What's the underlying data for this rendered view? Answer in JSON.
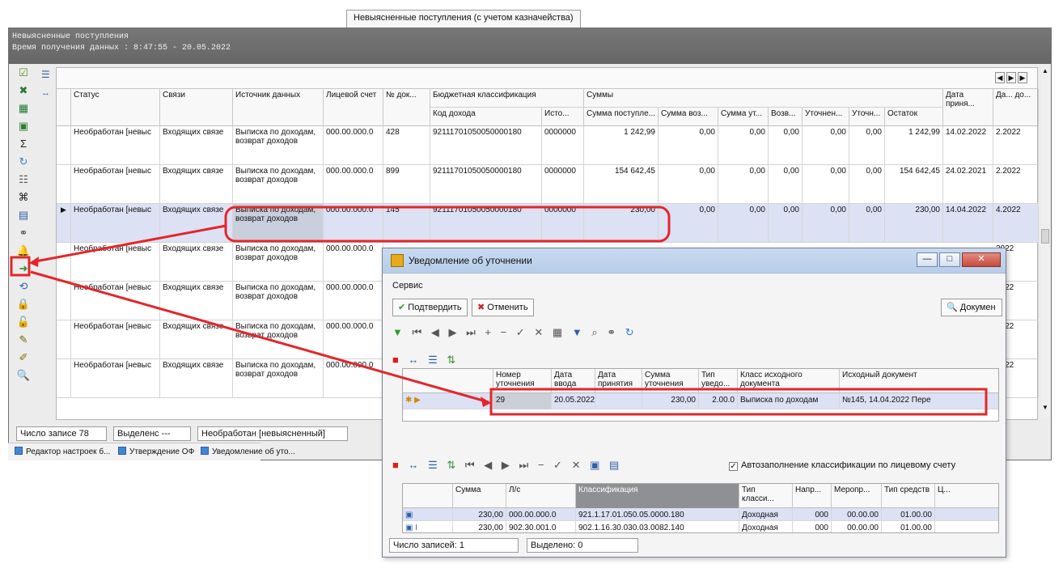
{
  "window": {
    "title_tab": "Невыясненные поступления (с учетом казначейства)",
    "header_line1": "Невыясненные поступления",
    "header_line2": "Время получения данных : 8:47:55 - 20.05.2022"
  },
  "colors": {
    "accent_red": "#e3262a",
    "highlight_blue": "#dce1f4",
    "header_gray": "#6d6d6d",
    "dialog_blue": "#c8daf1"
  },
  "left_toolbar_icons": [
    "check-icon",
    "close-icon",
    "excel-icon",
    "save-icon",
    "sum-icon",
    "refresh-icon",
    "filter-tree-icon",
    "binoculars-icon",
    "copy-icon",
    "link-icon",
    "bell-icon",
    "green-arrow-icon",
    "blue-refresh-icon",
    "lock-icon",
    "unlock-icon",
    "pen-icon",
    "brush-icon",
    "search-icon"
  ],
  "main_table": {
    "headers": {
      "status": "Статус",
      "links": "Связи",
      "source": "Источник данных",
      "account": "Лицевой счет",
      "doc_no": "№ док...",
      "budget_group": "Бюджетная классификация",
      "income_code": "Код дохода",
      "source_short": "Исто...",
      "sums_group": "Суммы",
      "sum_received": "Сумма поступле...",
      "sum_returned": "Сумма воз...",
      "sum_approved": "Сумма ут...",
      "return_short": "Возв...",
      "clarified": "Уточнен...",
      "clarify_short": "Уточн...",
      "remainder": "Остаток",
      "date_accept": "Дата приня...",
      "date_short": "Да... до..."
    },
    "rows": [
      {
        "status": "Необработан [невыс",
        "links": "Входящих связе",
        "source": "Выписка по доходам, возврат доходов",
        "account": "000.00.000.0",
        "doc_no": "428",
        "code": "92111701050050000180",
        "src": "0000000",
        "received": "1 242,99",
        "returned": "0,00",
        "approved": "0,00",
        "ret": "0,00",
        "clarified": "0,00",
        "clarify": "0,00",
        "remainder": "1 242,99",
        "date": "14.02.2022",
        "date2": "2.2022"
      },
      {
        "status": "Необработан [невыс",
        "links": "Входящих связе",
        "source": "Выписка по доходам, возврат доходов",
        "account": "000.00.000.0",
        "doc_no": "899",
        "code": "92111701050050000180",
        "src": "0000000",
        "received": "154 642,45",
        "returned": "0,00",
        "approved": "0,00",
        "ret": "0,00",
        "clarified": "0,00",
        "clarify": "0,00",
        "remainder": "154 642,45",
        "date": "24.02.2021",
        "date2": "2.2022"
      },
      {
        "status": "Необработан [невыс",
        "links": "Входящих связе",
        "source": "Выписка по доходам, возврат доходов",
        "account": "000.00.000.0",
        "doc_no": "145",
        "code": "92111701050050000180",
        "src": "0000000",
        "received": "230,00",
        "returned": "0,00",
        "approved": "0,00",
        "ret": "0,00",
        "clarified": "0,00",
        "clarify": "0,00",
        "remainder": "230,00",
        "date": "14.04.2022",
        "date2": "4.2022"
      },
      {
        "status": "Необработан [невыс",
        "links": "Входящих связе",
        "source": "Выписка по доходам, возврат доходов",
        "account": "000.00.000.0",
        "doc_no": "",
        "code": "",
        "src": "",
        "received": "",
        "returned": "",
        "approved": "",
        "ret": "",
        "clarified": "",
        "clarify": "",
        "remainder": "",
        "date": "",
        "date2": "2022"
      },
      {
        "status": "Необработан [невыс",
        "links": "Входящих связе",
        "source": "Выписка по доходам, возврат доходов",
        "account": "000.00.000.0",
        "doc_no": "",
        "code": "",
        "src": "",
        "received": "",
        "returned": "",
        "approved": "",
        "ret": "",
        "clarified": "",
        "clarify": "",
        "remainder": "",
        "date": "",
        "date2": "2022"
      },
      {
        "status": "Необработан [невыс",
        "links": "Входящих связе",
        "source": "Выписка по доходам, возврат доходов",
        "account": "000.00.000.0",
        "doc_no": "",
        "code": "",
        "src": "",
        "received": "",
        "returned": "",
        "approved": "",
        "ret": "",
        "clarified": "",
        "clarify": "",
        "remainder": "",
        "date": "",
        "date2": "2022"
      },
      {
        "status": "Необработан [невыс",
        "links": "Входящих связе",
        "source": "Выписка по доходам, возврат доходов",
        "account": "000.00.000.0",
        "doc_no": "",
        "code": "",
        "src": "",
        "received": "",
        "returned": "",
        "approved": "",
        "ret": "",
        "clarified": "",
        "clarify": "",
        "remainder": "",
        "date": "",
        "date2": "2022"
      }
    ]
  },
  "statusbar": {
    "records": "Число записе 78",
    "selected": "Выделенс ---",
    "current_status": "Необработан [невыясненный]"
  },
  "taskbar": {
    "items": [
      "Редактор настроек б...",
      "Утверждение ОФ",
      "Уведомление об уто..."
    ]
  },
  "dialog": {
    "title": "Уведомление об уточнении",
    "menu": "Сервис",
    "confirm": "Подтвердить",
    "cancel": "Отменить",
    "documents": "Докумен",
    "upper_table": {
      "headers": [
        "Номер уточнения",
        "Дата ввода",
        "Дата принятия",
        "Сумма уточнения",
        "Тип уведо...",
        "Класс исходного документа",
        "Исходный документ"
      ],
      "row": {
        "number": "29",
        "date_input": "20.05.2022",
        "date_accept": "",
        "sum": "230,00",
        "type": "2.00.0",
        "class": "Выписка по доходам",
        "document": "№145, 14.04.2022 Пере"
      }
    },
    "autofill_label": "Автозаполнение классификации по лицевому счету",
    "lower_table": {
      "headers": [
        "Сумма",
        "Л/с",
        "Классификация",
        "Тип класси...",
        "Напр...",
        "Меропр...",
        "Тип средств",
        "Ц..."
      ],
      "rows": [
        {
          "sum": "230,00",
          "account": "000.00.000.0",
          "classification": "921.1.17.01.050.05.0000.180",
          "type": "Доходная",
          "dir": "000",
          "event": "00.00.00",
          "funds": "01.00.00"
        },
        {
          "sum": "230,00",
          "account": "902.30.001.0",
          "classification": "902.1.16.30.030.03.0082.140",
          "type": "Доходная",
          "dir": "000",
          "event": "00.00.00",
          "funds": "01.00.00"
        }
      ]
    },
    "status_records": "Число записей: 1",
    "status_selected": "Выделено: 0"
  }
}
